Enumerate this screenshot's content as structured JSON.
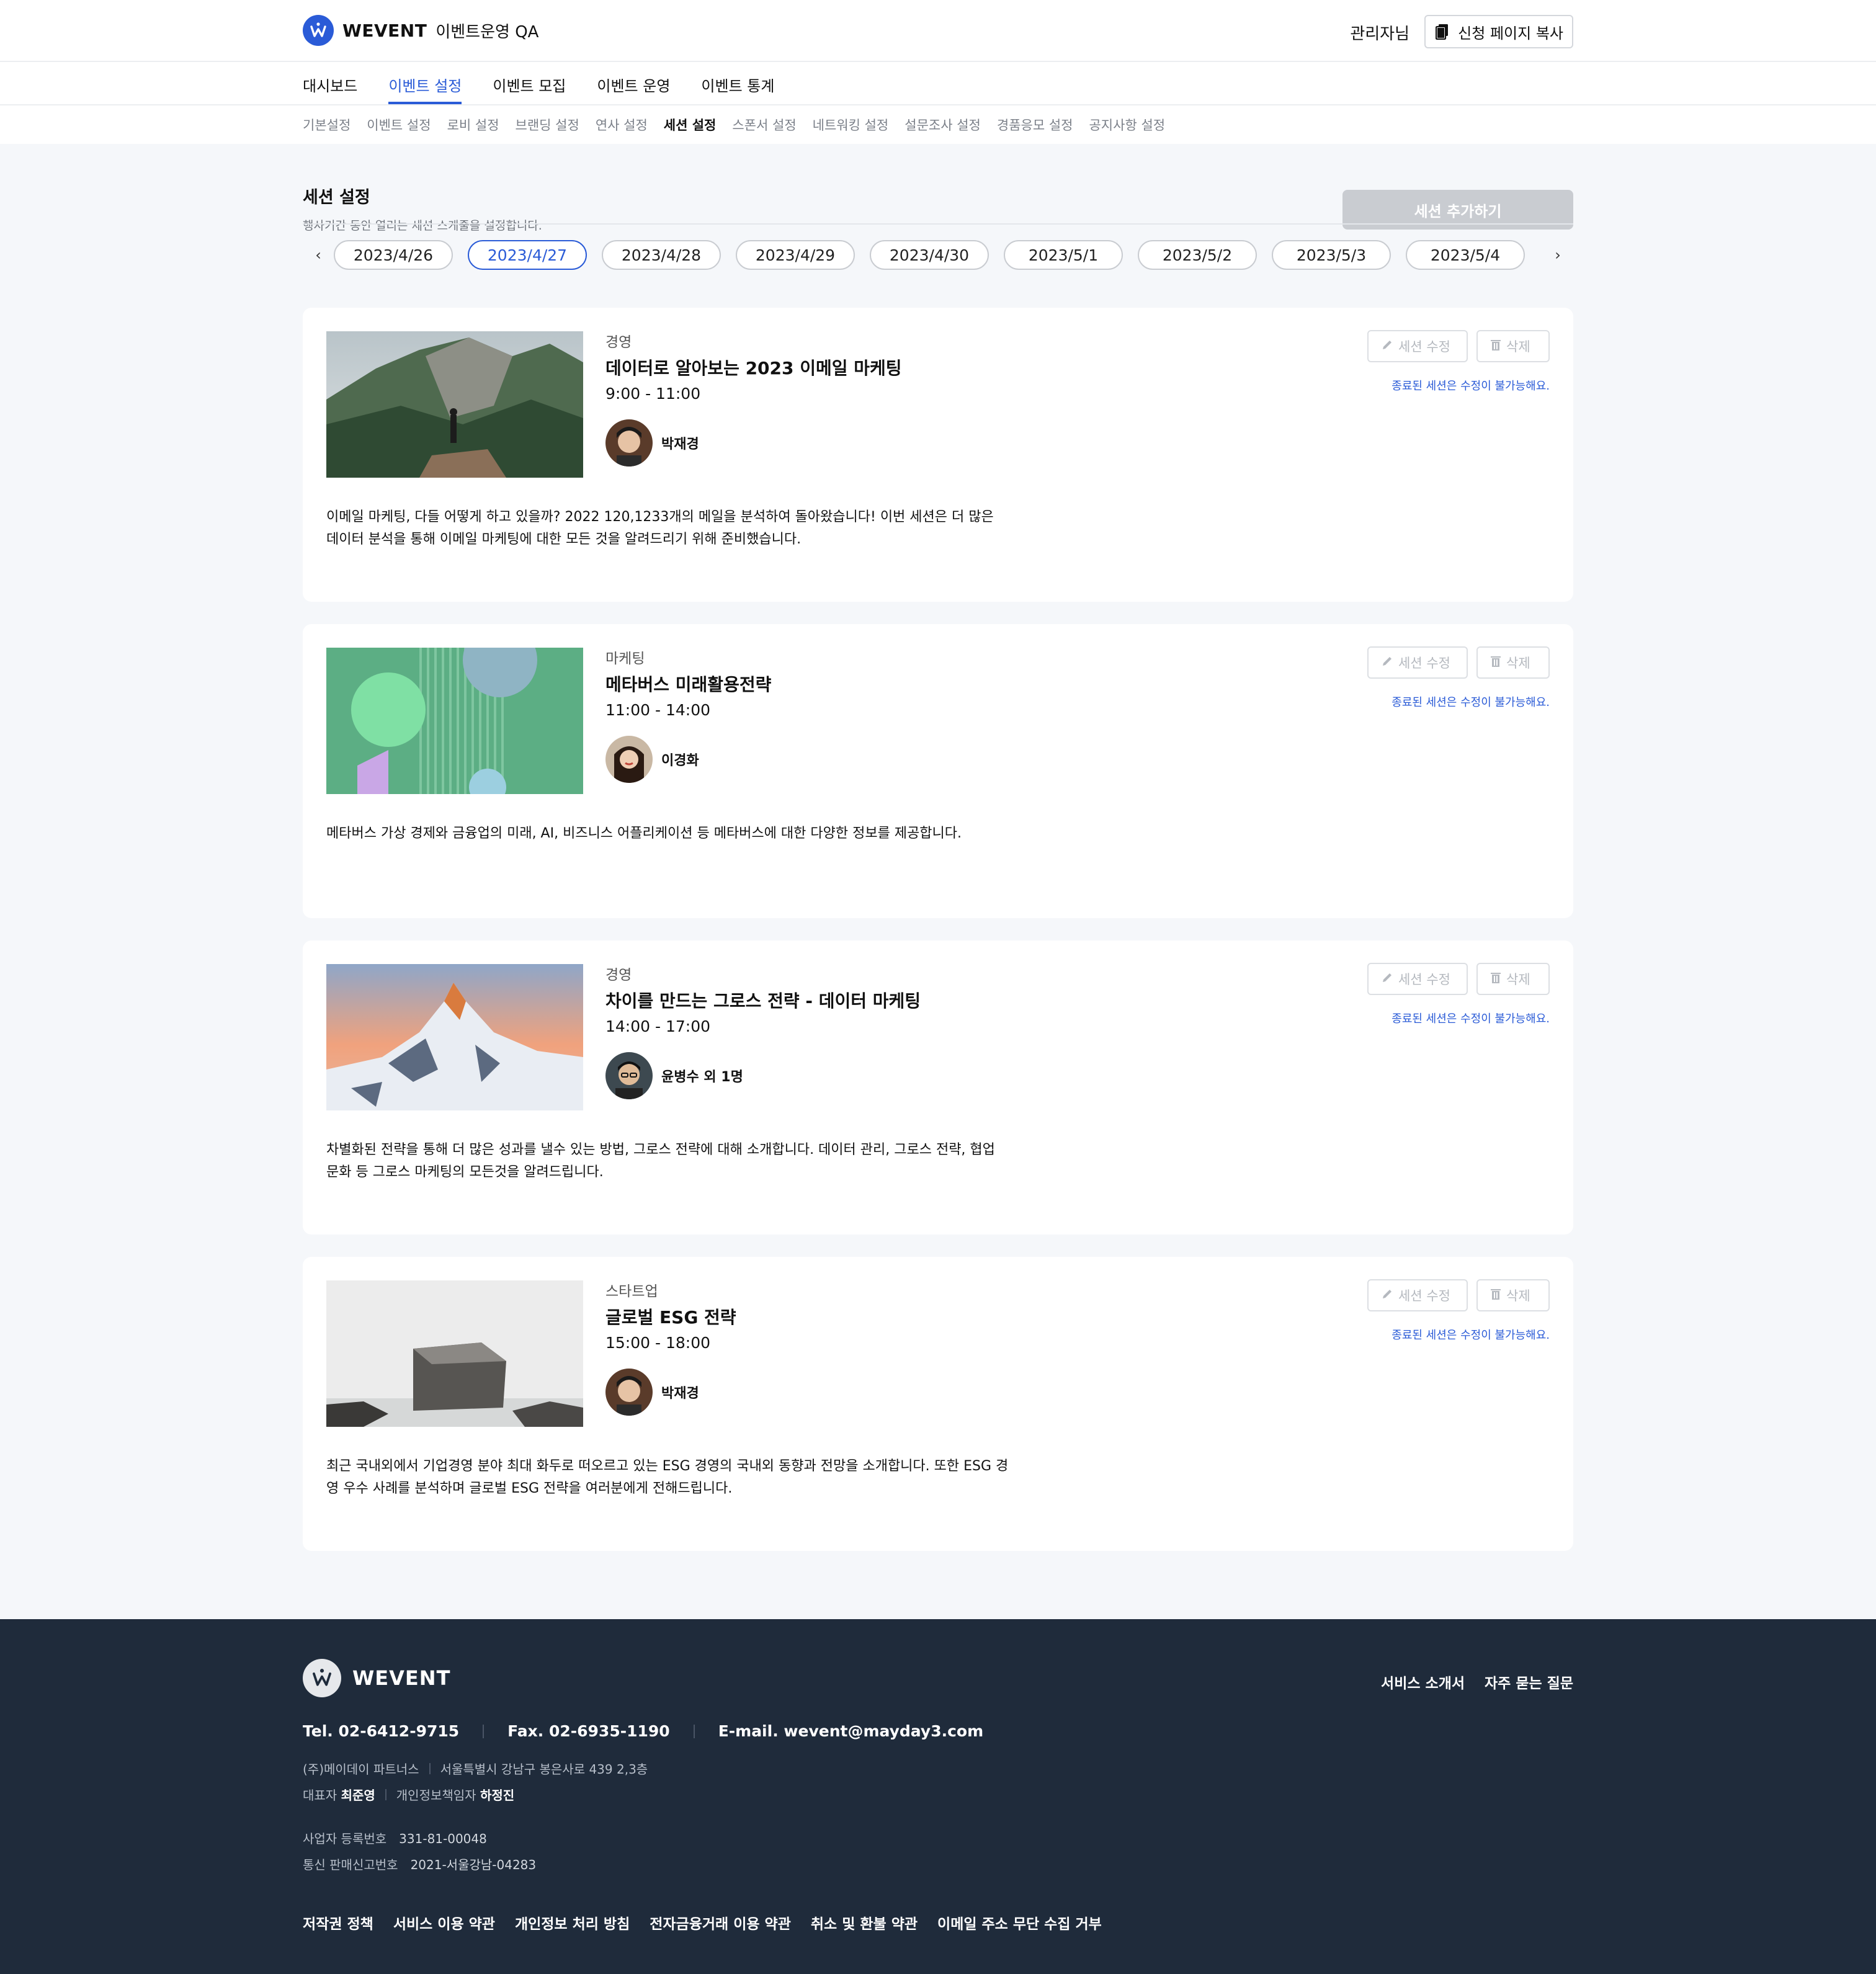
{
  "header": {
    "brand": "WEVENT",
    "event_name": "이벤트운영 QA",
    "admin": "관리자님",
    "copy_button": "신청 페이지 복사"
  },
  "main_nav": [
    "대시보드",
    "이벤트 설정",
    "이벤트 모집",
    "이벤트 운영",
    "이벤트 통계"
  ],
  "main_nav_active": "이벤트 설정",
  "sub_nav": [
    "기본설정",
    "이벤트 설정",
    "로비 설정",
    "브랜딩 설정",
    "연사 설정",
    "세션 설정",
    "스폰서 설정",
    "네트워킹 설정",
    "설문조사 설정",
    "경품응모 설정",
    "공지사항 설정"
  ],
  "sub_nav_active": "세션 설정",
  "section": {
    "title": "세션 설정",
    "description": "행사기간 동안 열리는 세션 스케줄을 설정합니다.",
    "add_button": "세션 추가하기"
  },
  "dates": [
    "2023/4/26",
    "2023/4/27",
    "2023/4/28",
    "2023/4/29",
    "2023/4/30",
    "2023/5/1",
    "2023/5/2",
    "2023/5/3",
    "2023/5/4"
  ],
  "active_date": "2023/4/27",
  "session_labels": {
    "edit": "세션 수정",
    "delete": "삭제",
    "note": "종료된 세션은 수정이 불가능해요."
  },
  "sessions": [
    {
      "category": "경영",
      "title": "데이터로 알아보는 2023 이메일 마케팅",
      "time": "9:00 - 11:00",
      "speaker": "박재경",
      "description": "이메일 마케팅, 다들 어떻게 하고 있을까? 2022 120,1233개의 메일을 분석하여 돌아왔습니다! 이번 세션은 더 많은 데이터 분석을 통해 이메일 마케팅에 대한 모든 것을 알려드리기 위해 준비했습니다."
    },
    {
      "category": "마케팅",
      "title": "메타버스 미래활용전략",
      "time": "11:00 - 14:00",
      "speaker": "이경화",
      "description": "메타버스 가상 경제와 금융업의 미래, AI, 비즈니스 어플리케이션 등 메타버스에 대한 다양한 정보를 제공합니다."
    },
    {
      "category": "경영",
      "title": "차이를 만드는 그로스 전략 - 데이터 마케팅",
      "time": "14:00 - 17:00",
      "speaker": "윤병수 외 1명",
      "description": "차별화된 전략을 통해 더 많은 성과를 낼수 있는 방법, 그로스 전략에 대해 소개합니다. 데이터 관리, 그로스 전략, 협업 문화 등 그로스 마케팅의 모든것을 알려드립니다."
    },
    {
      "category": "스타트업",
      "title": "글로벌 ESG 전략",
      "time": "15:00 - 18:00",
      "speaker": "박재경",
      "description": "최근 국내외에서 기업경영 분야 최대 화두로 떠오르고 있는 ESG 경영의 국내외 동향과 전망을 소개합니다. 또한 ESG 경영 우수 사례를 분석하며 글로벌 ESG 전략을 여러분에게 전해드립니다."
    }
  ],
  "footer": {
    "brand": "WEVENT",
    "top_links": [
      "서비스 소개서",
      "자주 묻는 질문"
    ],
    "tel": "Tel. 02-6412-9715",
    "fax": "Fax. 02-6935-1190",
    "email": "E-mail. wevent@mayday3.com",
    "company": "(주)메이데이 파트너스",
    "address": "서울특별시 강남구 봉은사로 439 2,3층",
    "ceo_label": "대표자",
    "ceo": "최준영",
    "privacy_label": "개인정보책임자",
    "privacy_officer": "하정진",
    "biz_reg_label": "사업자 등록번호",
    "biz_reg": "331-81-00048",
    "mail_order_label": "통신 판매신고번호",
    "mail_order": "2021-서울강남-04283",
    "bottom_links": [
      "저작권 정책",
      "서비스 이용 약관",
      "개인정보 처리 방침",
      "전자금융거래 이용 약관",
      "취소 및 환불 약관",
      "이메일 주소 무단 수집 거부"
    ]
  },
  "colors": {
    "accent": "#2a5bd7",
    "footer_bg": "#1f2b3b",
    "content_bg": "#f5f7fa"
  }
}
